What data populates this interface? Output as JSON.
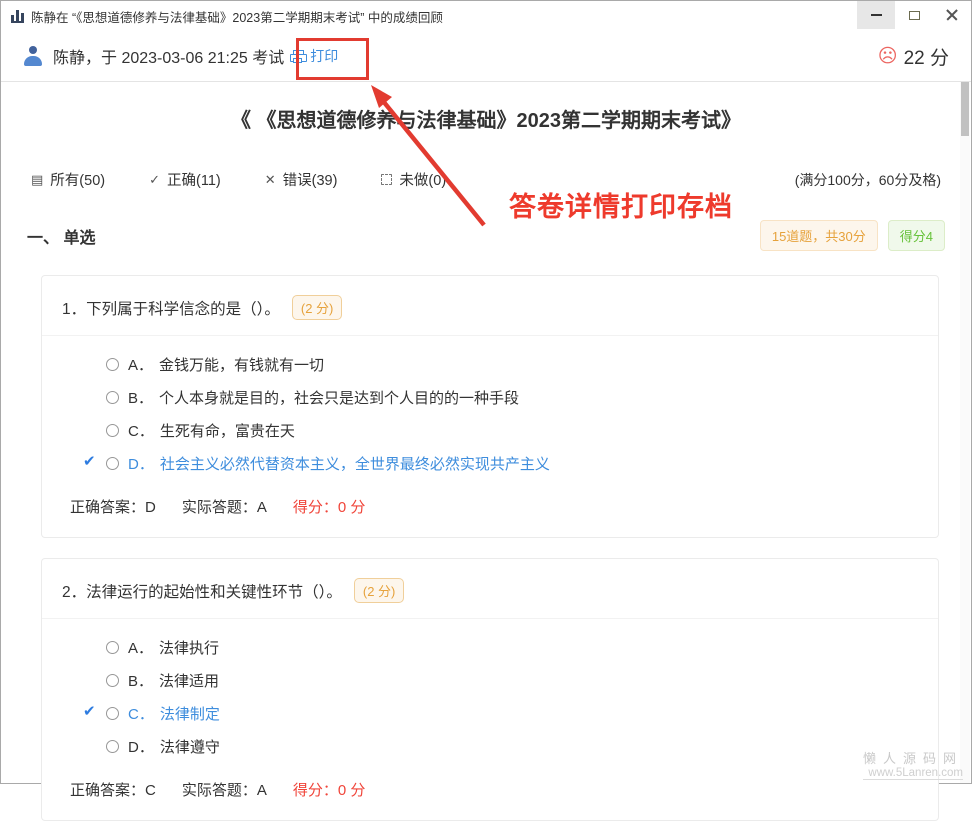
{
  "titlebar": {
    "title": "陈静在 “《思想道德修养与法律基础》2023第二学期期末考试” 中的成绩回顾"
  },
  "header": {
    "user_line": "陈静，于 2023-03-06 21:25 考试",
    "print_label": "打印",
    "score": "22 分"
  },
  "icons": {
    "sad_face": "☹",
    "filter_all": "▤",
    "filter_correct": "✓",
    "filter_wrong": "✕",
    "correct_check": "✔"
  },
  "annotation": {
    "note": "答卷详情打印存档"
  },
  "exam": {
    "title": "《 《思想道德修养与法律基础》2023第二学期期末考试》",
    "score_rule": "(满分100分，60分及格)",
    "filters": [
      {
        "label": "所有(50)"
      },
      {
        "label": "正确(11)"
      },
      {
        "label": "错误(39)"
      },
      {
        "label": "未做(0)"
      }
    ],
    "section": {
      "title": "一、 单选",
      "badge_count": "15道题，共30分",
      "badge_score": "得分4"
    },
    "questions": [
      {
        "title": "1．下列属于科学信念的是（）。",
        "points": "(2 分)",
        "options": [
          {
            "label": "A．",
            "text": "金钱万能，有钱就有一切"
          },
          {
            "label": "B．",
            "text": "个人本身就是目的，社会只是达到个人目的的一种手段"
          },
          {
            "label": "C．",
            "text": "生死有命，富贵在天"
          },
          {
            "label": "D．",
            "text": "社会主义必然代替资本主义，全世界最终必然实现共产主义"
          }
        ],
        "answer": {
          "correct_label": "正确答案：",
          "correct": "D",
          "actual_label": "实际答题：",
          "actual": "A",
          "score_label": "得分：",
          "score": "0 分"
        }
      },
      {
        "title": "2．法律运行的起始性和关键性环节（）。",
        "points": "(2 分)",
        "options": [
          {
            "label": "A．",
            "text": "法律执行"
          },
          {
            "label": "B．",
            "text": "法律适用"
          },
          {
            "label": "C．",
            "text": "法律制定"
          },
          {
            "label": "D．",
            "text": "法律遵守"
          }
        ],
        "answer": {
          "correct_label": "正确答案：",
          "correct": "C",
          "actual_label": "实际答题：",
          "actual": "A",
          "score_label": "得分：",
          "score": "0 分"
        }
      }
    ]
  },
  "watermark": {
    "line1": "懒人源码网",
    "line2": "www.5Lanren.com"
  },
  "colors": {
    "accent_blue": "#3e8ddd",
    "annotation_red": "#e23b30",
    "badge_orange": "#e6a23c",
    "badge_green": "#67c23a",
    "score_red": "#f0453a"
  }
}
